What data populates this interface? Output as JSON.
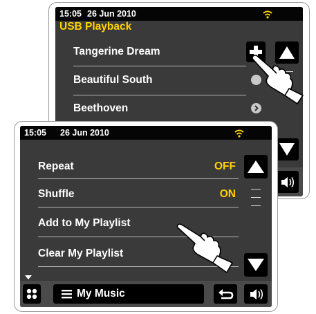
{
  "back_screen": {
    "status": {
      "time": "15:05",
      "date": "26 Jun 2010"
    },
    "title": "USB Playback",
    "items": [
      {
        "label": "Tangerine Dream"
      },
      {
        "label": "Beautiful South"
      },
      {
        "label": "Beethoven"
      }
    ]
  },
  "front_screen": {
    "status": {
      "time": "15:05",
      "date": "26 Jun 2010"
    },
    "rows": [
      {
        "label": "Repeat",
        "value": "OFF"
      },
      {
        "label": "Shuffle",
        "value": "ON"
      },
      {
        "label": "Add to My Playlist",
        "value": ""
      },
      {
        "label": "Clear My Playlist",
        "value": ""
      }
    ],
    "bottom_bar": {
      "menu_label": "My Music"
    }
  },
  "icons": {
    "wifi": "wifi-icon",
    "plus": "plus-icon",
    "scroll_up": "up-arrow-icon",
    "scroll_down": "down-arrow-icon",
    "volume": "volume-icon",
    "home": "home-grid-icon",
    "menu": "hamburger-icon",
    "back": "back-icon",
    "hand": "pointing-hand-icon",
    "more": "more-indicator-icon"
  },
  "colors": {
    "status_bar": "#050505",
    "screen_bg": "#3a3a3a",
    "title_yellow": "#ffd400",
    "value_yellow": "#ffd400",
    "wifi_yellow": "#ffd400",
    "button_bg": "#000000"
  }
}
